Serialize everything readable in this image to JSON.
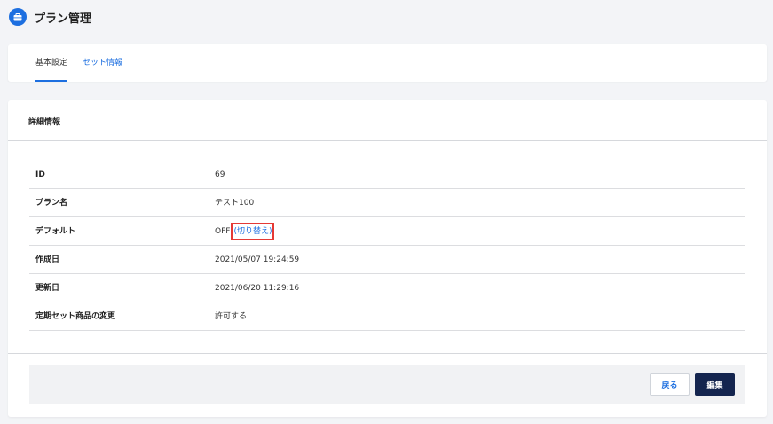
{
  "header": {
    "title": "プラン管理",
    "icon": "briefcase-icon",
    "brand_color": "#1d6fe0"
  },
  "tabs": [
    {
      "label": "基本設定",
      "active": true
    },
    {
      "label": "セット情報",
      "active": false
    }
  ],
  "detail": {
    "section_title": "詳細情報",
    "rows": [
      {
        "label": "ID",
        "value": "69"
      },
      {
        "label": "プラン名",
        "value": "テスト100"
      },
      {
        "label": "デフォルト",
        "value": "OFF",
        "link": "(切り替え)"
      },
      {
        "label": "作成日",
        "value": "2021/05/07 19:24:59"
      },
      {
        "label": "更新日",
        "value": "2021/06/20 11:29:16"
      },
      {
        "label": "定期セット商品の変更",
        "value": "許可する"
      }
    ]
  },
  "footer": {
    "back_label": "戻る",
    "edit_label": "編集"
  }
}
